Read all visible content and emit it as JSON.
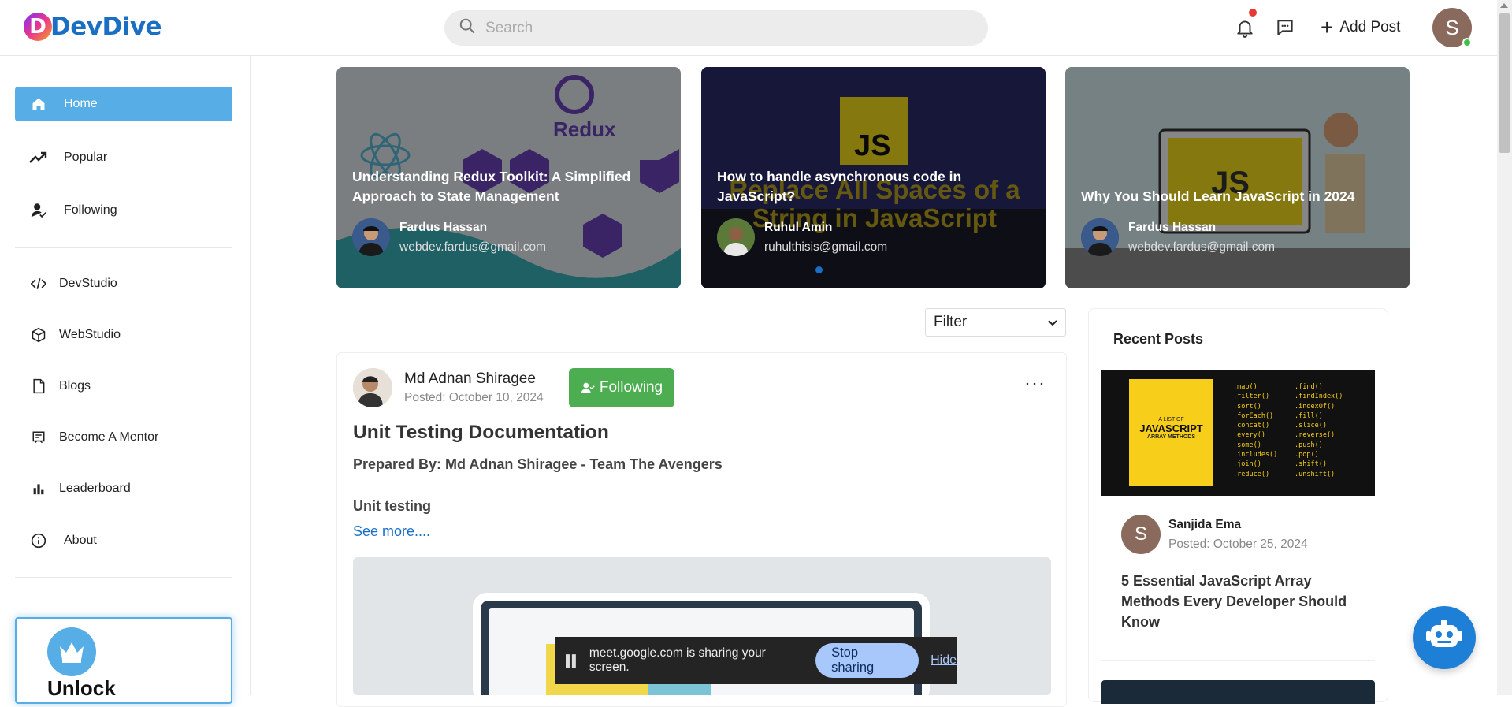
{
  "header": {
    "logo_text": "DevDive",
    "logo_letter": "D",
    "search_placeholder": "Search",
    "add_post_label": "Add Post",
    "avatar_initial": "S"
  },
  "sidebar": {
    "items": [
      {
        "label": "Home",
        "icon": "home-icon",
        "active": true
      },
      {
        "label": "Popular",
        "icon": "trending-icon"
      },
      {
        "label": "Following",
        "icon": "user-check-icon"
      },
      {
        "label": "DevStudio",
        "icon": "code-icon"
      },
      {
        "label": "WebStudio",
        "icon": "cube-icon"
      },
      {
        "label": "Blogs",
        "icon": "document-icon"
      },
      {
        "label": "Become A Mentor",
        "icon": "chalkboard-icon"
      },
      {
        "label": "Leaderboard",
        "icon": "bar-chart-icon"
      },
      {
        "label": "About",
        "icon": "info-icon"
      }
    ],
    "unlock_text": "Unlock"
  },
  "carousel": [
    {
      "title": "Understanding Redux Toolkit: A Simplified Approach to State Management",
      "author": "Fardus Hassan",
      "email": "webdev.fardus@gmail.com",
      "bg_text": "Redux"
    },
    {
      "title": "How to handle asynchronous code in JavaScript?",
      "author": "Ruhul Amin",
      "email": "ruhulthisis@gmail.com",
      "bg_text": "Replace All Spaces of a String in JavaScript",
      "badge": "JS"
    },
    {
      "title": "Why You Should Learn JavaScript in 2024",
      "author": "Fardus Hassan",
      "email": "webdev.fardus@gmail.com",
      "badge": "JS"
    }
  ],
  "filter": {
    "selected": "Filter"
  },
  "post": {
    "author": "Md Adnan Shiragee",
    "date": "Posted: October 10, 2024",
    "follow_label": "Following",
    "title": "Unit Testing Documentation",
    "prepared_by": "Prepared By: Md Adnan Shiragee - Team The Avengers",
    "section": "Unit testing",
    "see_more": "See more...."
  },
  "recent": {
    "title": "Recent Posts",
    "image": {
      "heading_small": "A LIST OF",
      "heading": "JAVASCRIPT",
      "subheading": "ARRAY METHODS",
      "methods_left": [
        ".map()",
        ".filter()",
        ".sort()",
        ".forEach()",
        ".concat()",
        ".every()",
        ".some()",
        ".includes()",
        ".join()",
        ".reduce()"
      ],
      "methods_right": [
        ".find()",
        ".findIndex()",
        ".indexOf()",
        ".fill()",
        ".slice()",
        ".reverse()",
        ".push()",
        ".pop()",
        ".shift()",
        ".unshift()"
      ]
    },
    "author_initial": "S",
    "author": "Sanjida Ema",
    "date": "Posted: October 25, 2024",
    "post_title": "5 Essential JavaScript Array Methods Every Developer Should Know"
  },
  "share_bar": {
    "text": "meet.google.com is sharing your screen.",
    "stop_label": "Stop sharing",
    "hide_label": "Hide"
  },
  "colors": {
    "accent": "#57aee6",
    "brand": "#1a6fc4",
    "follow": "#4cae50"
  }
}
